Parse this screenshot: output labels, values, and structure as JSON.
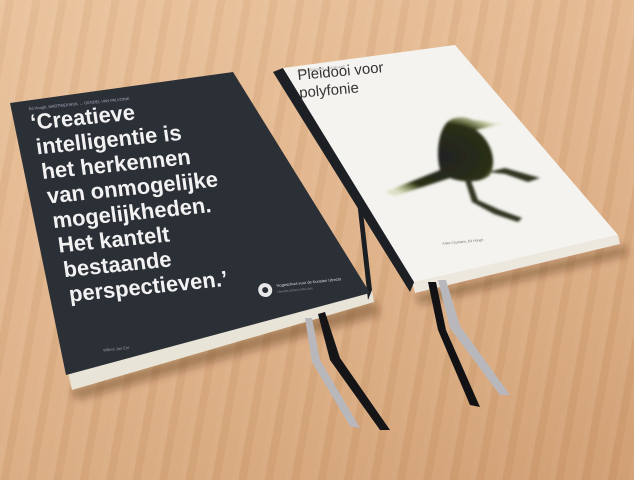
{
  "scene": {
    "background_color": "#e0b48a"
  },
  "book_left": {
    "cover_color": "#2b2f36",
    "header_small": "Ed Hoogh, MARTINEKWIJK ↔ GENDEL VAN PALVONIK",
    "quote_lines": [
      "‘Creatieve",
      "intelligentie is",
      "het herkennen",
      "van onmogelijke",
      "mogelijkheden.",
      "Het kantelt",
      "bestaande",
      "perspectieven.’"
    ],
    "publisher": "Hogeschool voor de Kunsten Utrecht",
    "publisher_sub": "Utrechts School of the Arts",
    "author_small": "Willem Jan Ent"
  },
  "book_right": {
    "cover_color": "#f4f3ef",
    "header_small": "Anke Coumans · Ed Hoogh",
    "title_line1": "Pleidooi voor",
    "title_line2": "polyfonie",
    "authors_small": "Anke Coumans, Ed Hoogh",
    "illustration": "bird-silhouette"
  }
}
